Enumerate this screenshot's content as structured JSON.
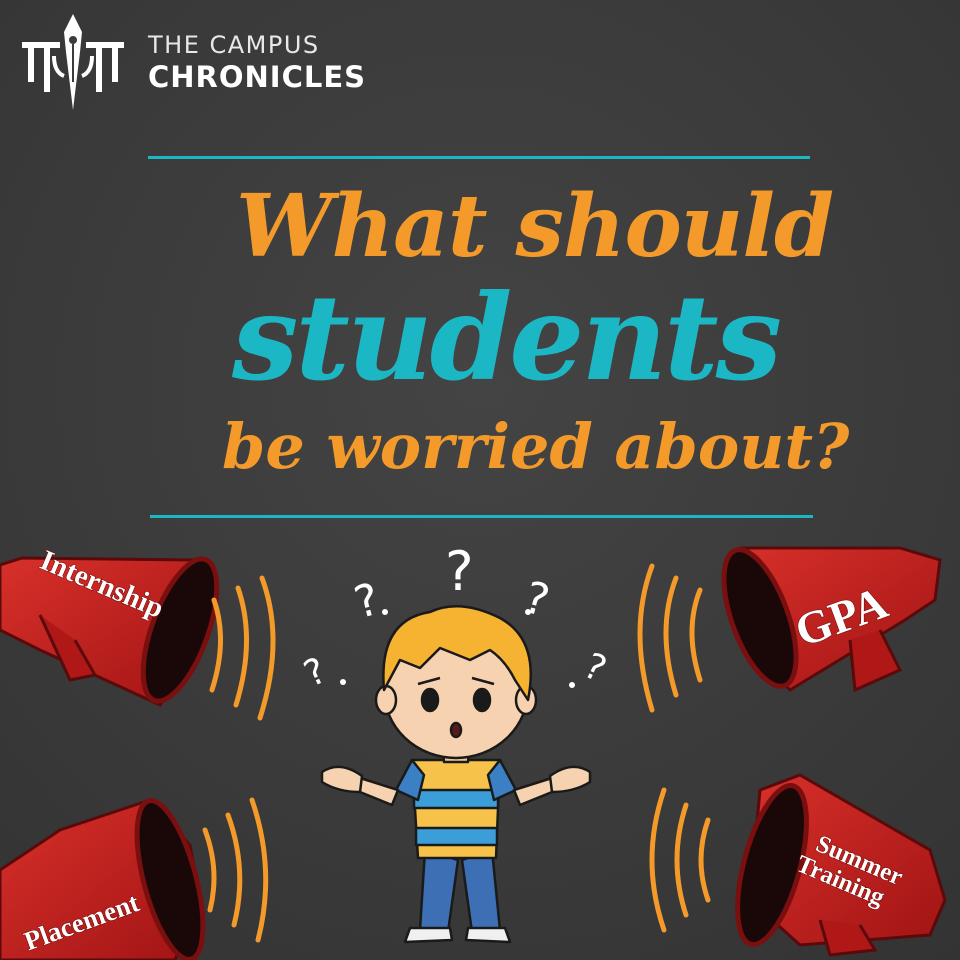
{
  "brand": {
    "name_line1": "THE CAMPUS",
    "name_line2": "CHRONICLES",
    "logo_icon": "pen-nib-logo-icon"
  },
  "headline": {
    "line1": "What should",
    "line2": "students",
    "line3": "be worried about?"
  },
  "megaphones": {
    "top_left": "Internship",
    "top_right": "GPA",
    "bottom_left": "Placement",
    "bottom_right_line1": "Summer",
    "bottom_right_line2": "Training"
  },
  "question_marks": [
    "?",
    "?",
    "?",
    "?",
    "?"
  ],
  "colors": {
    "background": "#3b3b3b",
    "accent_orange": "#f39a2a",
    "accent_teal": "#1cb7c4",
    "megaphone_red": "#c41e1e",
    "text_white": "#ffffff"
  }
}
